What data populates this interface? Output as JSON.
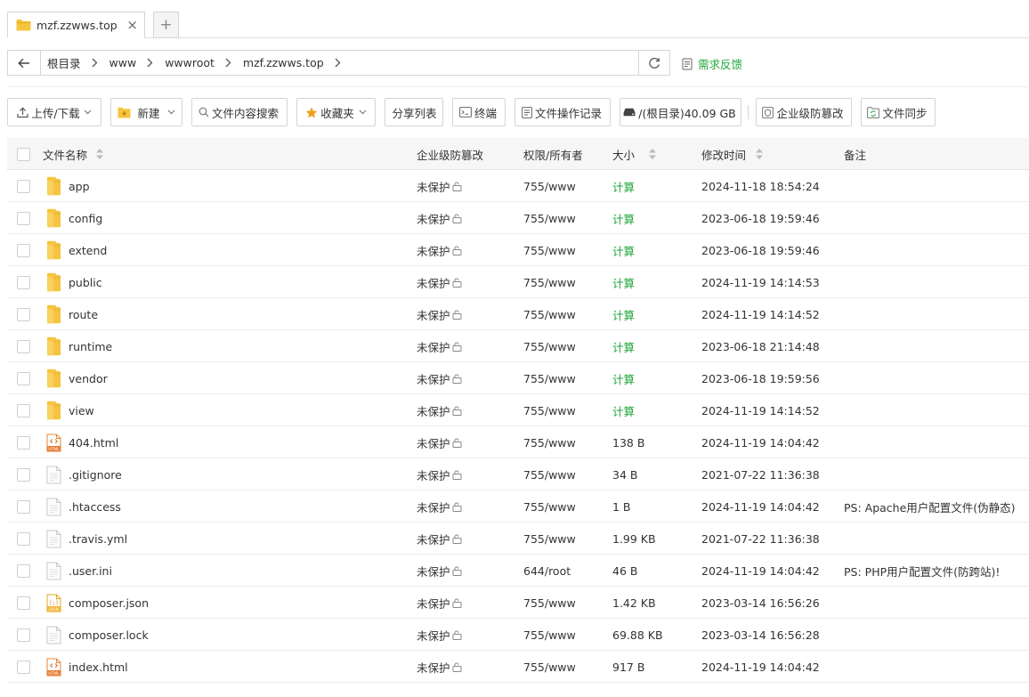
{
  "tab": {
    "title": "mzf.zzwws.top",
    "close": "×",
    "add": "+"
  },
  "breadcrumb": [
    "根目录",
    "www",
    "wwwroot",
    "mzf.zzwws.top"
  ],
  "feedback": "需求反馈",
  "toolbar": {
    "upload": "上传/下载",
    "new": "新建",
    "search": "文件内容搜索",
    "favorites": "收藏夹",
    "share": "分享列表",
    "terminal": "终端",
    "oplog": "文件操作记录",
    "disk": "/(根目录)40.09 GB",
    "tamper": "企业级防篡改",
    "sync": "文件同步"
  },
  "table": {
    "headers": {
      "name": "文件名称",
      "protect": "企业级防篡改",
      "perm": "权限/所有者",
      "size": "大小",
      "time": "修改时间",
      "note": "备注"
    },
    "rows": [
      {
        "type": "folder",
        "name": "app",
        "protect": "未保护",
        "perm": "755/www",
        "size": "计算",
        "time": "2024-11-18 18:54:24",
        "note": ""
      },
      {
        "type": "folder",
        "name": "config",
        "protect": "未保护",
        "perm": "755/www",
        "size": "计算",
        "time": "2023-06-18 19:59:46",
        "note": ""
      },
      {
        "type": "folder",
        "name": "extend",
        "protect": "未保护",
        "perm": "755/www",
        "size": "计算",
        "time": "2023-06-18 19:59:46",
        "note": ""
      },
      {
        "type": "folder",
        "name": "public",
        "protect": "未保护",
        "perm": "755/www",
        "size": "计算",
        "time": "2024-11-19 14:14:53",
        "note": ""
      },
      {
        "type": "folder",
        "name": "route",
        "protect": "未保护",
        "perm": "755/www",
        "size": "计算",
        "time": "2024-11-19 14:14:52",
        "note": ""
      },
      {
        "type": "folder",
        "name": "runtime",
        "protect": "未保护",
        "perm": "755/www",
        "size": "计算",
        "time": "2023-06-18 21:14:48",
        "note": ""
      },
      {
        "type": "folder",
        "name": "vendor",
        "protect": "未保护",
        "perm": "755/www",
        "size": "计算",
        "time": "2023-06-18 19:59:56",
        "note": ""
      },
      {
        "type": "folder",
        "name": "view",
        "protect": "未保护",
        "perm": "755/www",
        "size": "计算",
        "time": "2024-11-19 14:14:52",
        "note": ""
      },
      {
        "type": "html",
        "name": "404.html",
        "protect": "未保护",
        "perm": "755/www",
        "size": "138 B",
        "time": "2024-11-19 14:04:42",
        "note": ""
      },
      {
        "type": "file",
        "name": ".gitignore",
        "protect": "未保护",
        "perm": "755/www",
        "size": "34 B",
        "time": "2021-07-22 11:36:38",
        "note": ""
      },
      {
        "type": "file",
        "name": ".htaccess",
        "protect": "未保护",
        "perm": "755/www",
        "size": "1 B",
        "time": "2024-11-19 14:04:42",
        "note": "PS: Apache用户配置文件(伪静态)"
      },
      {
        "type": "file",
        "name": ".travis.yml",
        "protect": "未保护",
        "perm": "755/www",
        "size": "1.99 KB",
        "time": "2021-07-22 11:36:38",
        "note": ""
      },
      {
        "type": "file",
        "name": ".user.ini",
        "protect": "未保护",
        "perm": "644/root",
        "size": "46 B",
        "time": "2024-11-19 14:04:42",
        "note": "PS: PHP用户配置文件(防跨站)!"
      },
      {
        "type": "json",
        "name": "composer.json",
        "protect": "未保护",
        "perm": "755/www",
        "size": "1.42 KB",
        "time": "2023-03-14 16:56:26",
        "note": ""
      },
      {
        "type": "file",
        "name": "composer.lock",
        "protect": "未保护",
        "perm": "755/www",
        "size": "69.88 KB",
        "time": "2023-03-14 16:56:28",
        "note": ""
      },
      {
        "type": "html",
        "name": "index.html",
        "protect": "未保护",
        "perm": "755/www",
        "size": "917 B",
        "time": "2024-11-19 14:04:42",
        "note": ""
      }
    ]
  },
  "colors": {
    "accent": "#20a53a",
    "folder": "#f5c440",
    "favorite": "#f0a020"
  },
  "icons": [
    "folder-icon",
    "close-icon",
    "plus-icon",
    "arrow-left-icon",
    "chevron-right-icon",
    "refresh-icon",
    "feedback-icon",
    "upload-icon",
    "new-folder-icon",
    "search-icon",
    "star-icon",
    "terminal-icon",
    "log-icon",
    "disk-icon",
    "shield-icon",
    "sync-icon",
    "lock-icon",
    "sort-icon",
    "html-file-icon",
    "json-file-icon",
    "file-icon"
  ]
}
